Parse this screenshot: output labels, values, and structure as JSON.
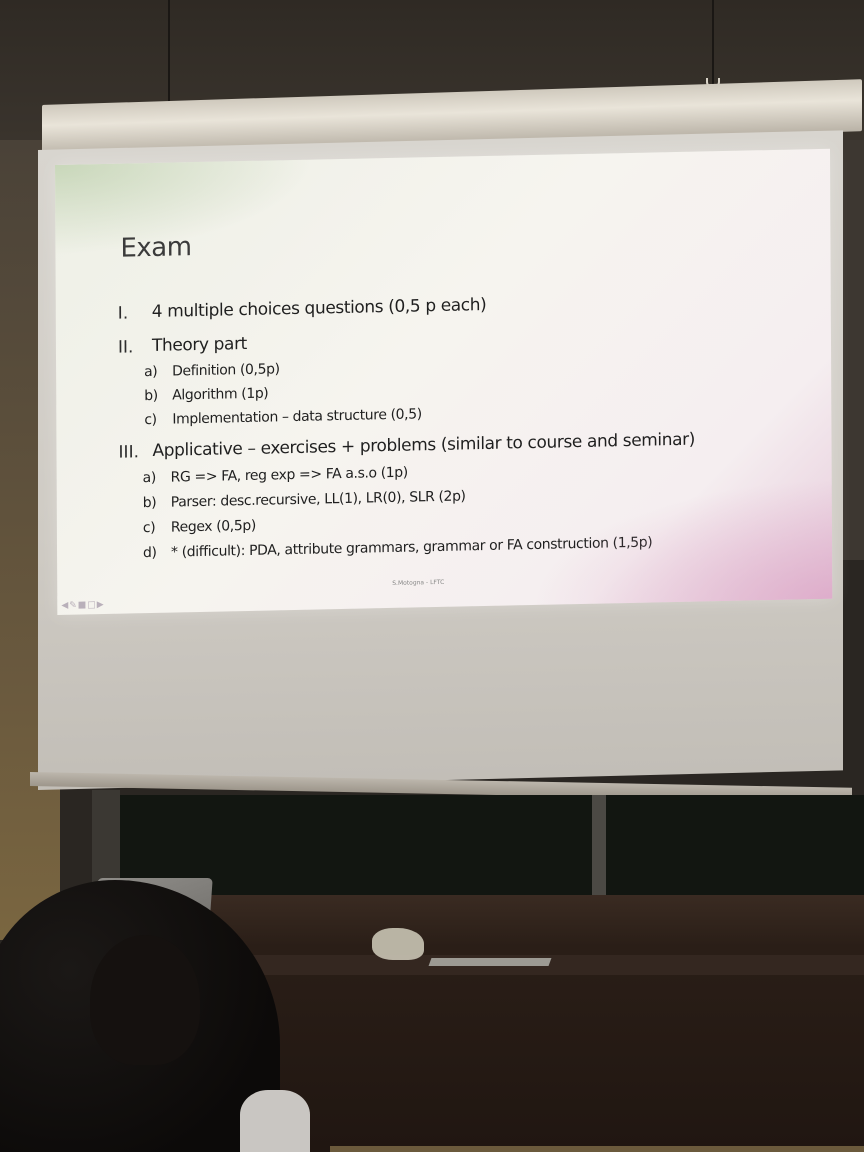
{
  "slide": {
    "title": "Exam",
    "items": [
      {
        "numeral": "I.",
        "text": "4 multiple choices questions (0,5 p each)"
      },
      {
        "numeral": "II.",
        "text": "Theory part",
        "subitems": [
          {
            "letter": "a)",
            "text": "Definition (0,5p)"
          },
          {
            "letter": "b)",
            "text": "Algorithm (1p)"
          },
          {
            "letter": "c)",
            "text": "Implementation – data structure (0,5)"
          }
        ]
      },
      {
        "numeral": "III.",
        "text": "Applicative – exercises + problems (similar to course and seminar)",
        "subitems": [
          {
            "letter": "a)",
            "text": "RG => FA, reg exp => FA a.s.o (1p)"
          },
          {
            "letter": "b)",
            "text": "Parser: desc.recursive, LL(1), LR(0), SLR (2p)"
          },
          {
            "letter": "c)",
            "text": "Regex (0,5p)"
          },
          {
            "letter": "d)",
            "text": "* (difficult): PDA, attribute grammars, grammar or FA construction (1,5p)"
          }
        ]
      }
    ],
    "footer": "S.Motogna - LFTC"
  },
  "colors": {
    "slide_bg": "#f6f4ef",
    "slide_accent_green": "#aac396",
    "slide_accent_pink": "#d796be",
    "room_dark": "#2a2622"
  },
  "icons": {
    "nav": "slide-navigation-icons",
    "laptop_logo": "apple-logo-icon"
  }
}
